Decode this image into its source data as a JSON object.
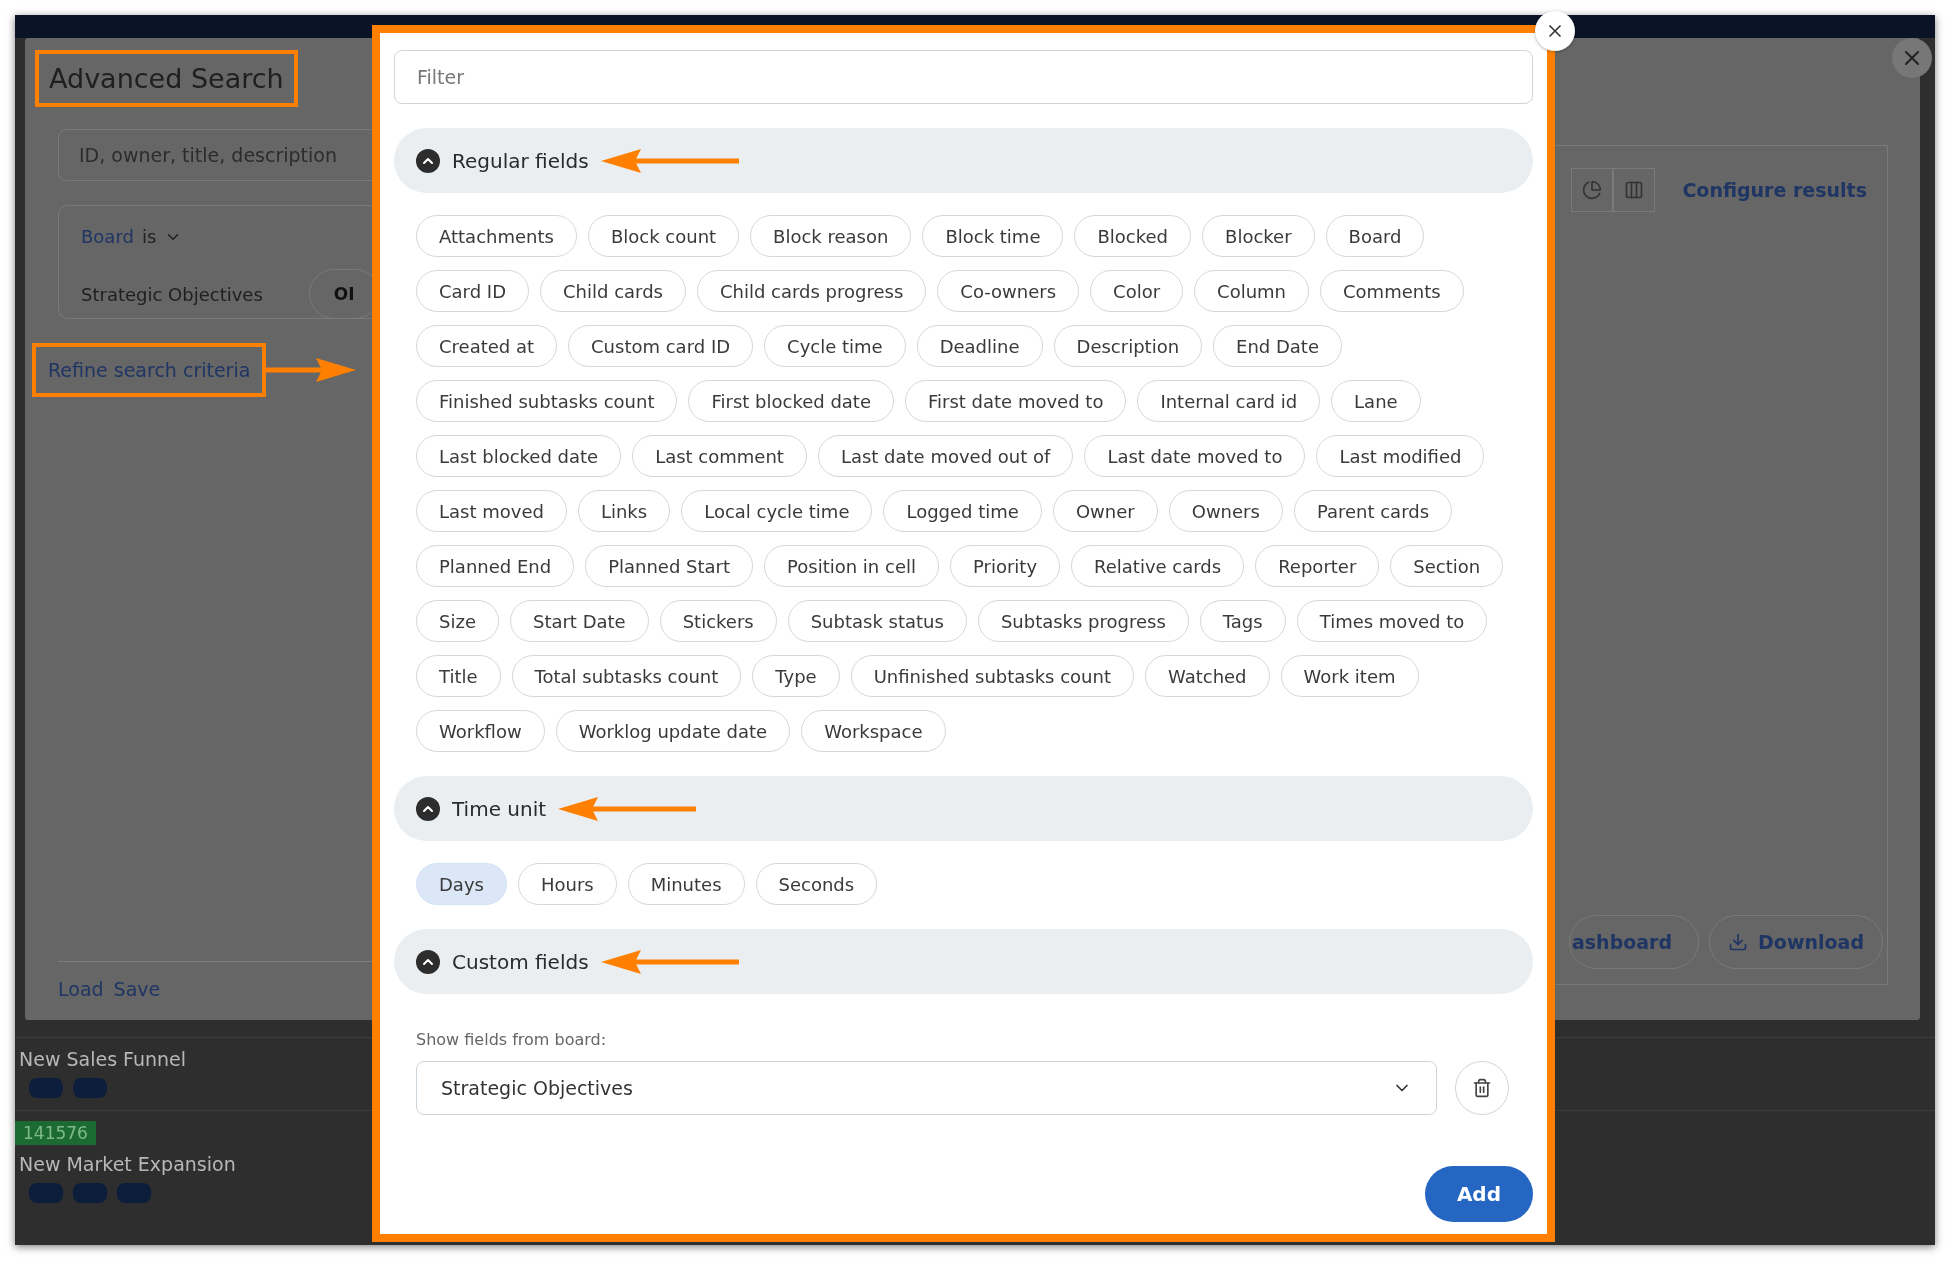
{
  "dialog": {
    "title": "Advanced Search",
    "search": {
      "placeholder": "ID, owner, title, description"
    },
    "board_filter": {
      "label": "Board",
      "operator": "is",
      "value": "Strategic Objectives",
      "chip": "OI"
    },
    "refine_link": "Refine search criteria",
    "footer_links": [
      "Load",
      "Save"
    ],
    "results": {
      "configure": "Configure results",
      "buttons": [
        {
          "label": "ashboard",
          "kind": "plain"
        },
        {
          "label": "Download",
          "kind": "download"
        }
      ]
    }
  },
  "background_cards": [
    {
      "title": "New Sales Funnel",
      "tags": [
        {
          "kind": "tag"
        },
        {
          "kind": "tag"
        }
      ]
    },
    {
      "title": "New Market Expansion",
      "id": "141576",
      "tags": [
        {
          "kind": "tag"
        },
        {
          "kind": "tag"
        },
        {
          "kind": "tag"
        }
      ]
    }
  ],
  "popup": {
    "filter": {
      "placeholder": "Filter"
    },
    "sections": [
      {
        "kind": "fields",
        "title": "Regular fields",
        "expanded": true,
        "chips": [
          "Attachments",
          "Block count",
          "Block reason",
          "Block time",
          "Blocked",
          "Blocker",
          "Board",
          "Card ID",
          "Child cards",
          "Child cards progress",
          "Co-owners",
          "Color",
          "Column",
          "Comments",
          "Created at",
          "Custom card ID",
          "Cycle time",
          "Deadline",
          "Description",
          "End Date",
          "Finished subtasks count",
          "First blocked date",
          "First date moved to",
          "Internal card id",
          "Lane",
          "Last blocked date",
          "Last comment",
          "Last date moved out of",
          "Last date moved to",
          "Last modified",
          "Last moved",
          "Links",
          "Local cycle time",
          "Logged time",
          "Owner",
          "Owners",
          "Parent cards",
          "Planned End",
          "Planned Start",
          "Position in cell",
          "Priority",
          "Relative cards",
          "Reporter",
          "Section",
          "Size",
          "Start Date",
          "Stickers",
          "Subtask status",
          "Subtasks progress",
          "Tags",
          "Times moved to",
          "Title",
          "Total subtasks count",
          "Type",
          "Unfinished subtasks count",
          "Watched",
          "Work item",
          "Workflow",
          "Worklog update date",
          "Workspace"
        ]
      },
      {
        "kind": "units",
        "title": "Time unit",
        "expanded": true,
        "units": [
          {
            "label": "Days",
            "selected": true
          },
          {
            "label": "Hours",
            "selected": false
          },
          {
            "label": "Minutes",
            "selected": false
          },
          {
            "label": "Seconds",
            "selected": false
          }
        ]
      },
      {
        "kind": "custom",
        "title": "Custom fields",
        "expanded": true,
        "board_label": "Show fields from board:",
        "board_value": "Strategic Objectives"
      }
    ],
    "add_button": "Add"
  }
}
